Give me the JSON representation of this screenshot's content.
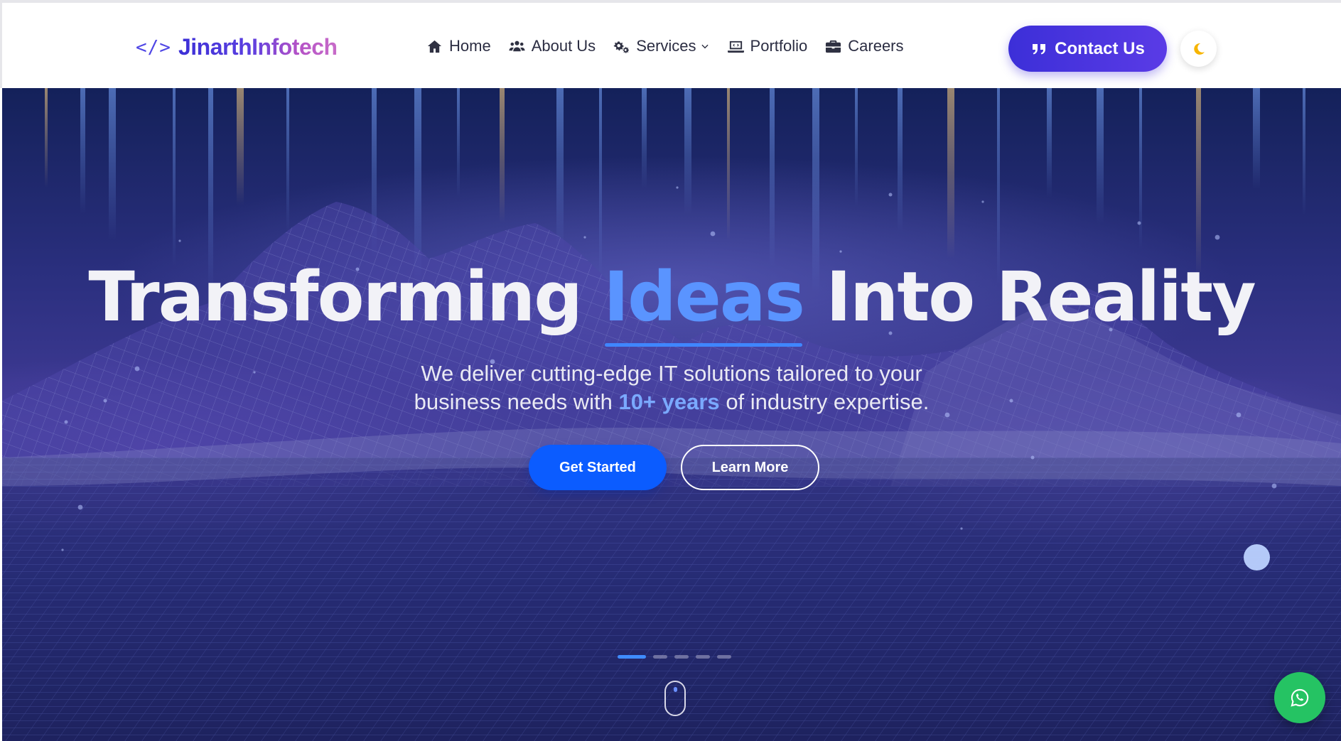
{
  "header": {
    "logo_code": "</>",
    "logo_text": "JinarthInfotech",
    "nav": [
      {
        "label": "Home",
        "icon": "home-icon"
      },
      {
        "label": "About Us",
        "icon": "users-icon"
      },
      {
        "label": "Services",
        "icon": "gears-icon",
        "has_dropdown": true
      },
      {
        "label": "Portfolio",
        "icon": "laptop-code-icon"
      },
      {
        "label": "Careers",
        "icon": "briefcase-icon"
      }
    ],
    "contact_label": "Contact Us",
    "theme_toggle_icon": "moon-icon"
  },
  "hero": {
    "title_part1": "Transforming",
    "title_highlight": "Ideas",
    "title_part2": "Into Reality",
    "subtitle_line1": "We deliver cutting-edge IT solutions tailored to your",
    "subtitle_line2_before": "business needs with",
    "subtitle_accent": "10+ years",
    "subtitle_line2_after": "of industry expertise.",
    "primary_cta": "Get Started",
    "secondary_cta": "Learn More",
    "slide_count": 5,
    "active_slide": 1
  },
  "floating": {
    "whatsapp_icon": "whatsapp-icon"
  },
  "colors": {
    "brand": "#4f46e5",
    "highlight": "#5a94ff",
    "primary_button": "#0b5cff",
    "whatsapp": "#25c363",
    "moon": "#f7b500"
  }
}
